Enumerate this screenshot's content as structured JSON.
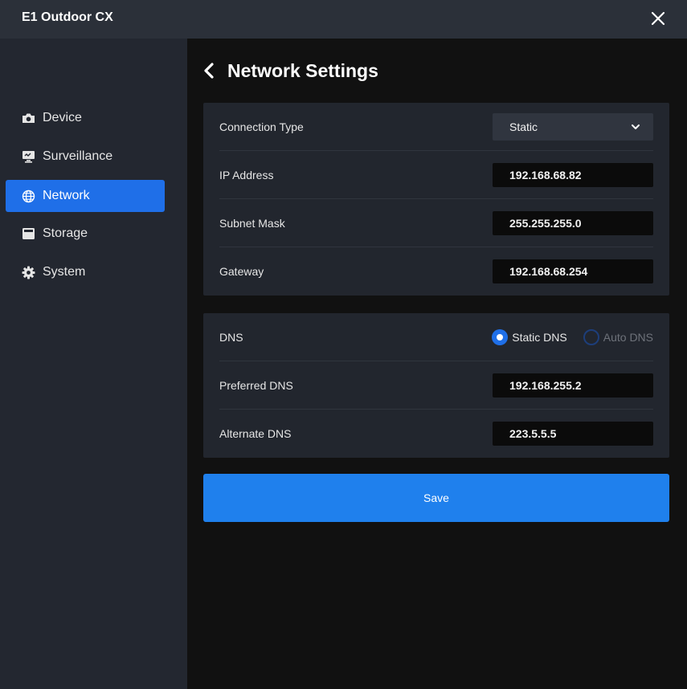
{
  "window": {
    "title": "E1 Outdoor CX"
  },
  "sidebar": {
    "items": [
      {
        "label": "Device",
        "icon": "camera-icon",
        "active": false
      },
      {
        "label": "Surveillance",
        "icon": "monitor-icon",
        "active": false
      },
      {
        "label": "Network",
        "icon": "globe-icon",
        "active": true
      },
      {
        "label": "Storage",
        "icon": "storage-icon",
        "active": false
      },
      {
        "label": "System",
        "icon": "gear-icon",
        "active": false
      }
    ]
  },
  "page": {
    "title": "Network Settings"
  },
  "ip_card": {
    "connection_type_label": "Connection Type",
    "connection_type_value": "Static",
    "ip_address_label": "IP Address",
    "ip_address_value": "192.168.68.82",
    "subnet_mask_label": "Subnet Mask",
    "subnet_mask_value": "255.255.255.0",
    "gateway_label": "Gateway",
    "gateway_value": "192.168.68.254"
  },
  "dns_card": {
    "dns_label": "DNS",
    "static_dns_label": "Static DNS",
    "auto_dns_label": "Auto DNS",
    "selected": "Static DNS",
    "preferred_dns_label": "Preferred DNS",
    "preferred_dns_value": "192.168.255.2",
    "alternate_dns_label": "Alternate DNS",
    "alternate_dns_value": "223.5.5.5"
  },
  "actions": {
    "save_label": "Save"
  },
  "colors": {
    "accent": "#1f6fe8",
    "save_button": "#1f80ed",
    "titlebar": "#2b3039",
    "sidebar": "#232730",
    "card": "#22262e",
    "background": "#111111"
  }
}
